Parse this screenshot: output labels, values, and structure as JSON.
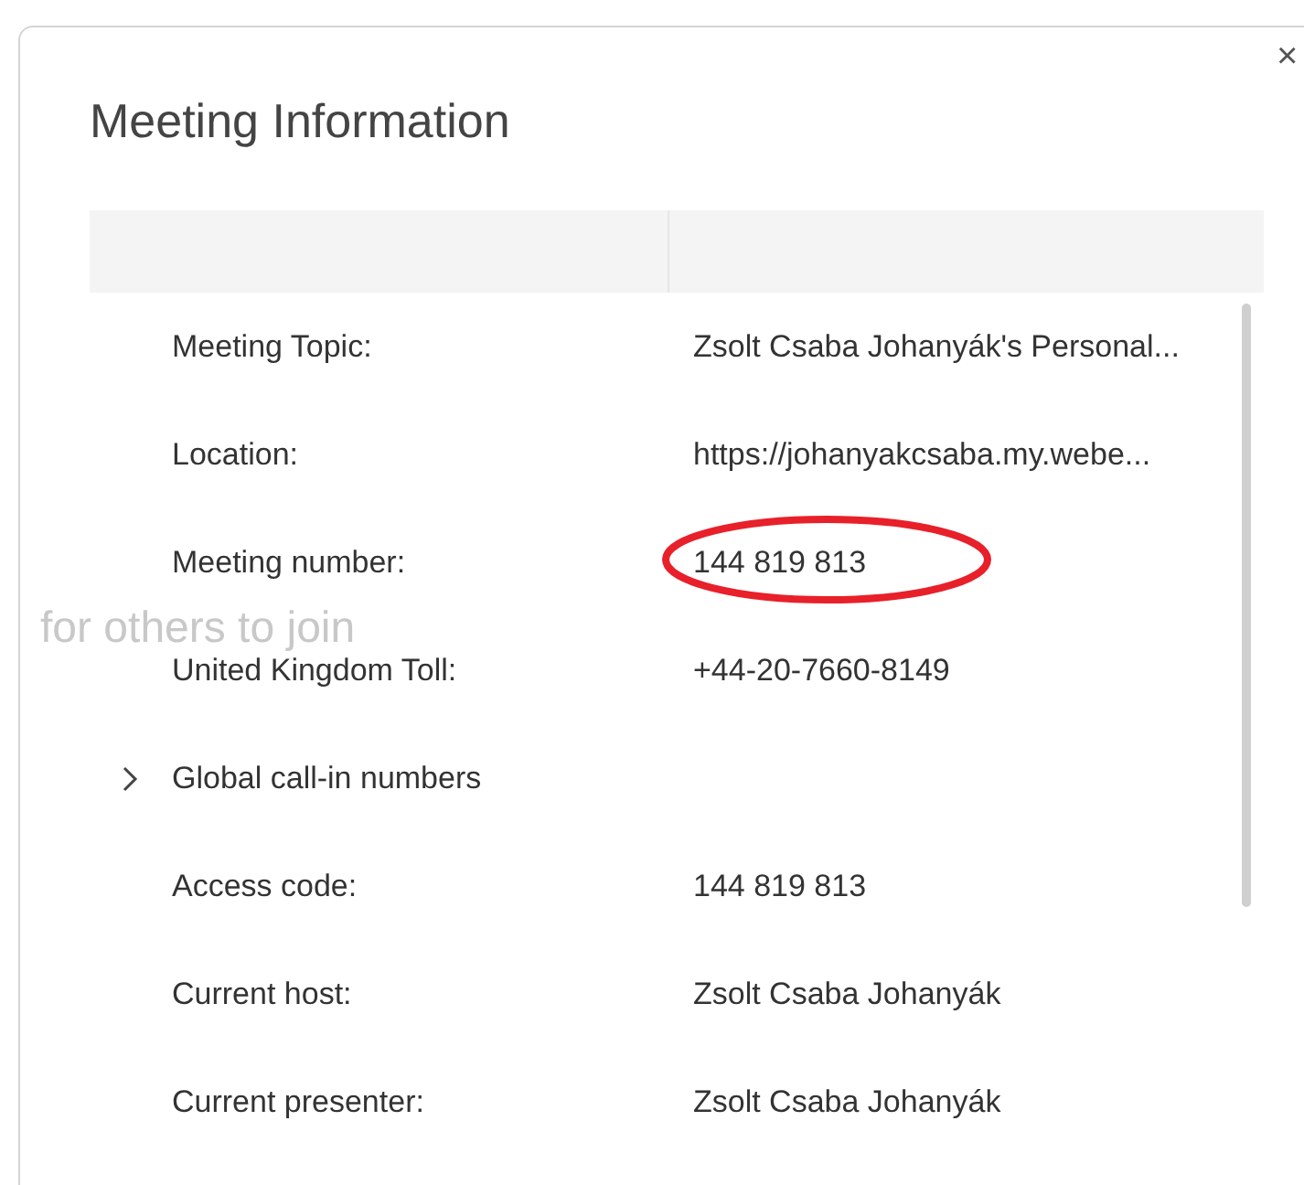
{
  "dialog": {
    "title": "Meeting Information",
    "close_glyph": "×"
  },
  "background_text": "for others to join",
  "rows": [
    {
      "kind": "field",
      "label": "Meeting Topic:",
      "value": "Zsolt Csaba Johanyák's Personal...",
      "circled": false
    },
    {
      "kind": "field",
      "label": "Location:",
      "value": "https://johanyakcsaba.my.webe...",
      "circled": false
    },
    {
      "kind": "field",
      "label": "Meeting number:",
      "value": "144 819 813",
      "circled": true
    },
    {
      "kind": "field",
      "label": "United Kingdom Toll:",
      "value": "+44-20-7660-8149",
      "circled": false
    },
    {
      "kind": "expander",
      "label": "Global call-in numbers",
      "expanded": false
    },
    {
      "kind": "field",
      "label": "Access code:",
      "value": "144 819 813",
      "circled": false
    },
    {
      "kind": "field",
      "label": "Current host:",
      "value": "Zsolt Csaba Johanyák",
      "circled": false
    },
    {
      "kind": "field",
      "label": "Current presenter:",
      "value": "Zsolt Csaba Johanyák",
      "circled": false
    }
  ]
}
